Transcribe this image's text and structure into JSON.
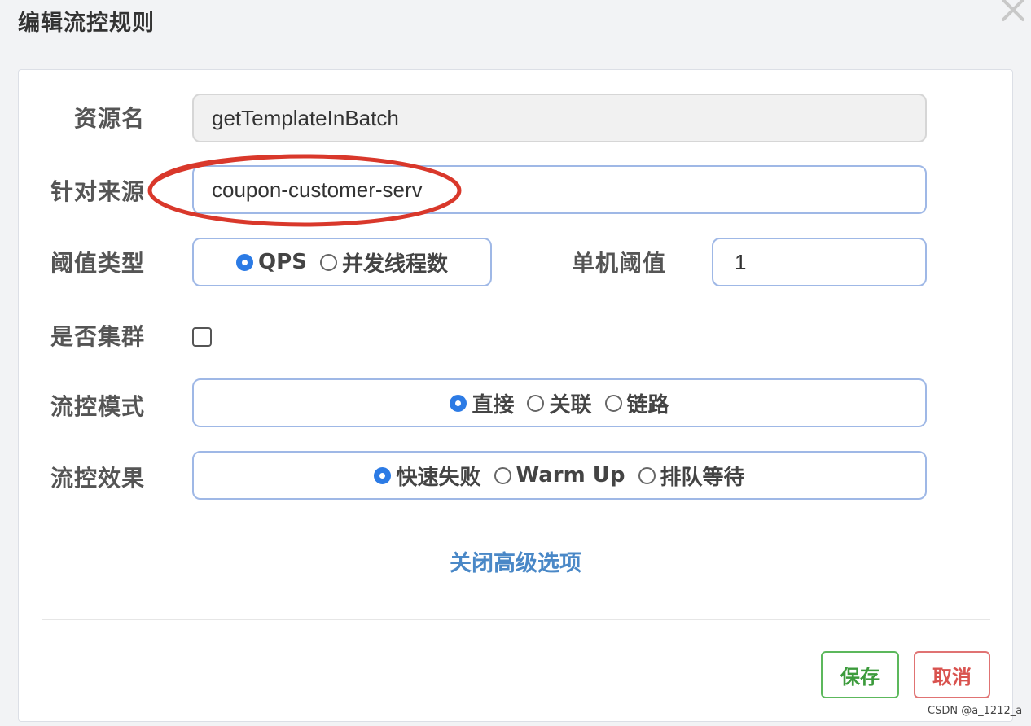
{
  "dialog": {
    "title": "编辑流控规则"
  },
  "form": {
    "resource_label": "资源名",
    "resource_value": "getTemplateInBatch",
    "source_label": "针对来源",
    "source_value": "coupon-customer-serv",
    "threshold_type_label": "阈值类型",
    "threshold_type_options": [
      "QPS",
      "并发线程数"
    ],
    "threshold_type_selected": "QPS",
    "single_threshold_label": "单机阈值",
    "single_threshold_value": "1",
    "cluster_label": "是否集群",
    "cluster_checked": false,
    "mode_label": "流控模式",
    "mode_options": [
      "直接",
      "关联",
      "链路"
    ],
    "mode_selected": "直接",
    "effect_label": "流控效果",
    "effect_options": [
      "快速失败",
      "Warm Up",
      "排队等待"
    ],
    "effect_selected": "快速失败",
    "advanced_toggle": "关闭高级选项"
  },
  "footer": {
    "save_label": "保存",
    "cancel_label": "取消"
  },
  "watermark": "CSDN @a_1212_a",
  "colors": {
    "accent": "#2c7be5",
    "input_border": "#9fb8e6",
    "link": "#4a88c7",
    "save": "#5cb85c",
    "cancel": "#d9534f",
    "annotation": "#d9382b"
  },
  "icons": {
    "close": "close-icon"
  }
}
